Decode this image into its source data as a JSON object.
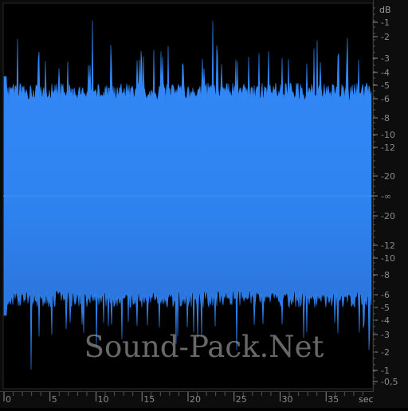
{
  "waveform": {
    "fill_color": "#2f86f4",
    "fill_color_dark": "#2a6fd0",
    "background_color": "#000000",
    "duration_sec": 39.5,
    "envelope_level_db": -5
  },
  "db_ruler": {
    "unit_label": "dB",
    "upper_labels": [
      "-1",
      "-2",
      "-3",
      "-4",
      "-5",
      "-6",
      "-8",
      "-10",
      "-12",
      "-20"
    ],
    "center_label": "-∞",
    "lower_labels": [
      "-20",
      "-12",
      "-10",
      "-8",
      "-6",
      "-5",
      "-4",
      "-3",
      "-2",
      "-1",
      "-0,5"
    ]
  },
  "time_ruler": {
    "unit_label": "sec",
    "labels": [
      "0",
      "5",
      "10",
      "15",
      "20",
      "25",
      "30",
      "35"
    ]
  },
  "watermark": {
    "text": "Sound-Pack.Net"
  }
}
